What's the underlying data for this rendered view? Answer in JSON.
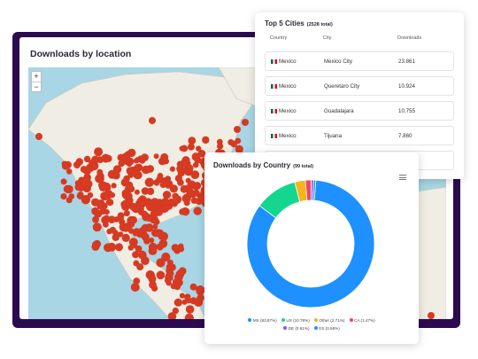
{
  "location_panel": {
    "title": "Downloads by location",
    "zoom_in": "+",
    "zoom_out": "−"
  },
  "cities_card": {
    "title": "Top 5 Cities",
    "total": "(2528 total)",
    "columns": [
      "Country",
      "City",
      "Downloads"
    ],
    "rows": [
      {
        "country": "Mexico",
        "city": "Mexico City",
        "downloads": "23.861"
      },
      {
        "country": "Mexico",
        "city": "Queretaro City",
        "downloads": "10.924"
      },
      {
        "country": "Mexico",
        "city": "Guadalajara",
        "downloads": "10.755"
      },
      {
        "country": "Mexico",
        "city": "Tijuana",
        "downloads": "7.860"
      }
    ]
  },
  "country_card": {
    "title": "Downloads by Country",
    "total": "(99 total)",
    "menu_icon": "hamburger-icon"
  },
  "chart_data": {
    "type": "pie",
    "donut": true,
    "categories": [
      "MX",
      "US",
      "Other",
      "CA",
      "DE",
      "ES"
    ],
    "values": [
      83.87,
      10.78,
      2.71,
      1.47,
      0.61,
      0.56
    ],
    "colors": [
      "#1e90ff",
      "#14d68f",
      "#f7b21c",
      "#f0455d",
      "#7a5af0",
      "#1e90ff"
    ],
    "legend_labels": [
      "MX (83.87%)",
      "US (10.78%)",
      "Other (2.71%)",
      "CA (1.47%)",
      "DE (0.61%)",
      "ES (0.56%)"
    ],
    "legend": "bottom"
  },
  "map_marker_color": "#d63a22"
}
